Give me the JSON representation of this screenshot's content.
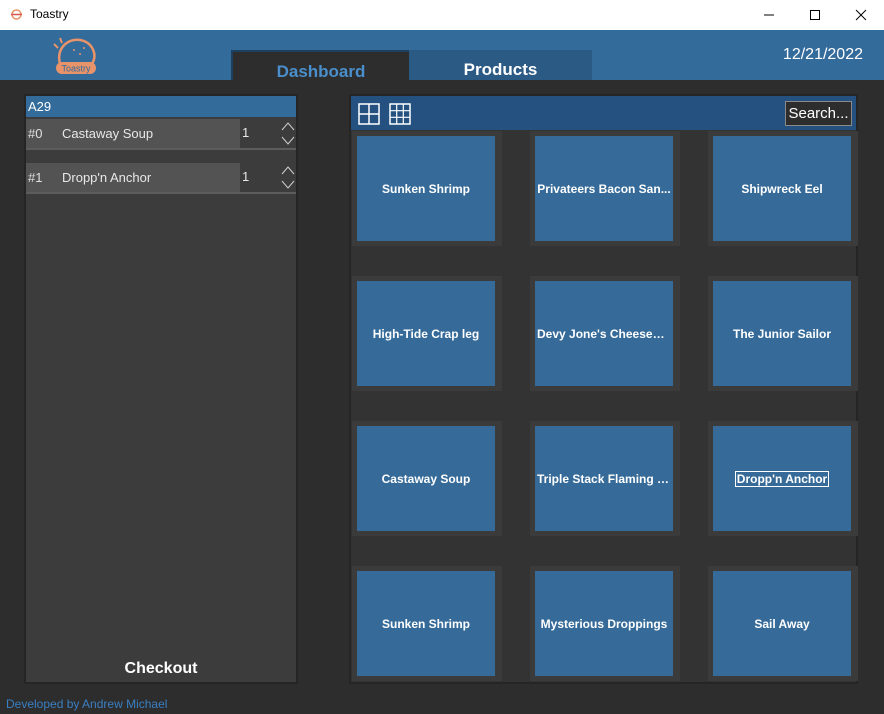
{
  "window": {
    "title": "Toastry",
    "app_icon": "toaster-icon",
    "controls": [
      "minimize-icon",
      "maximize-icon",
      "close-icon"
    ]
  },
  "header": {
    "logo_text": "Toastry",
    "date": "12/21/2022",
    "tabs": [
      {
        "label": "Dashboard",
        "active": true
      },
      {
        "label": "Products",
        "active": false
      }
    ]
  },
  "order": {
    "table_id": "A29",
    "items": [
      {
        "index": "#0",
        "name": "Castaway Soup",
        "qty": "1"
      },
      {
        "index": "#1",
        "name": "Dropp'n Anchor",
        "qty": "1"
      }
    ],
    "checkout_label": "Checkout"
  },
  "products": {
    "view_icons": [
      "grid-2x2-icon",
      "grid-3x3-icon"
    ],
    "search_label": "Search...",
    "items": [
      {
        "label": "Sunken Shrimp"
      },
      {
        "label": "Privateers Bacon San..."
      },
      {
        "label": "Shipwreck Eel"
      },
      {
        "label": "High-Tide Crap leg"
      },
      {
        "label": "Devy Jone's Cheesebu..."
      },
      {
        "label": "The Junior Sailor"
      },
      {
        "label": "Castaway Soup"
      },
      {
        "label": "Triple Stack Flaming C..."
      },
      {
        "label": "Dropp'n Anchor",
        "focused": true
      },
      {
        "label": "Sunken Shrimp"
      },
      {
        "label": "Mysterious Droppings"
      },
      {
        "label": "Sail Away"
      }
    ]
  },
  "footer": {
    "credit": "Developed by Andrew Michael"
  },
  "colors": {
    "brand_blue": "#336b9b",
    "tile_blue": "#366b99",
    "dark_bg": "#2d2d2d",
    "logo_orange": "#e8936a",
    "tab_active_text": "#4a8fcb"
  }
}
